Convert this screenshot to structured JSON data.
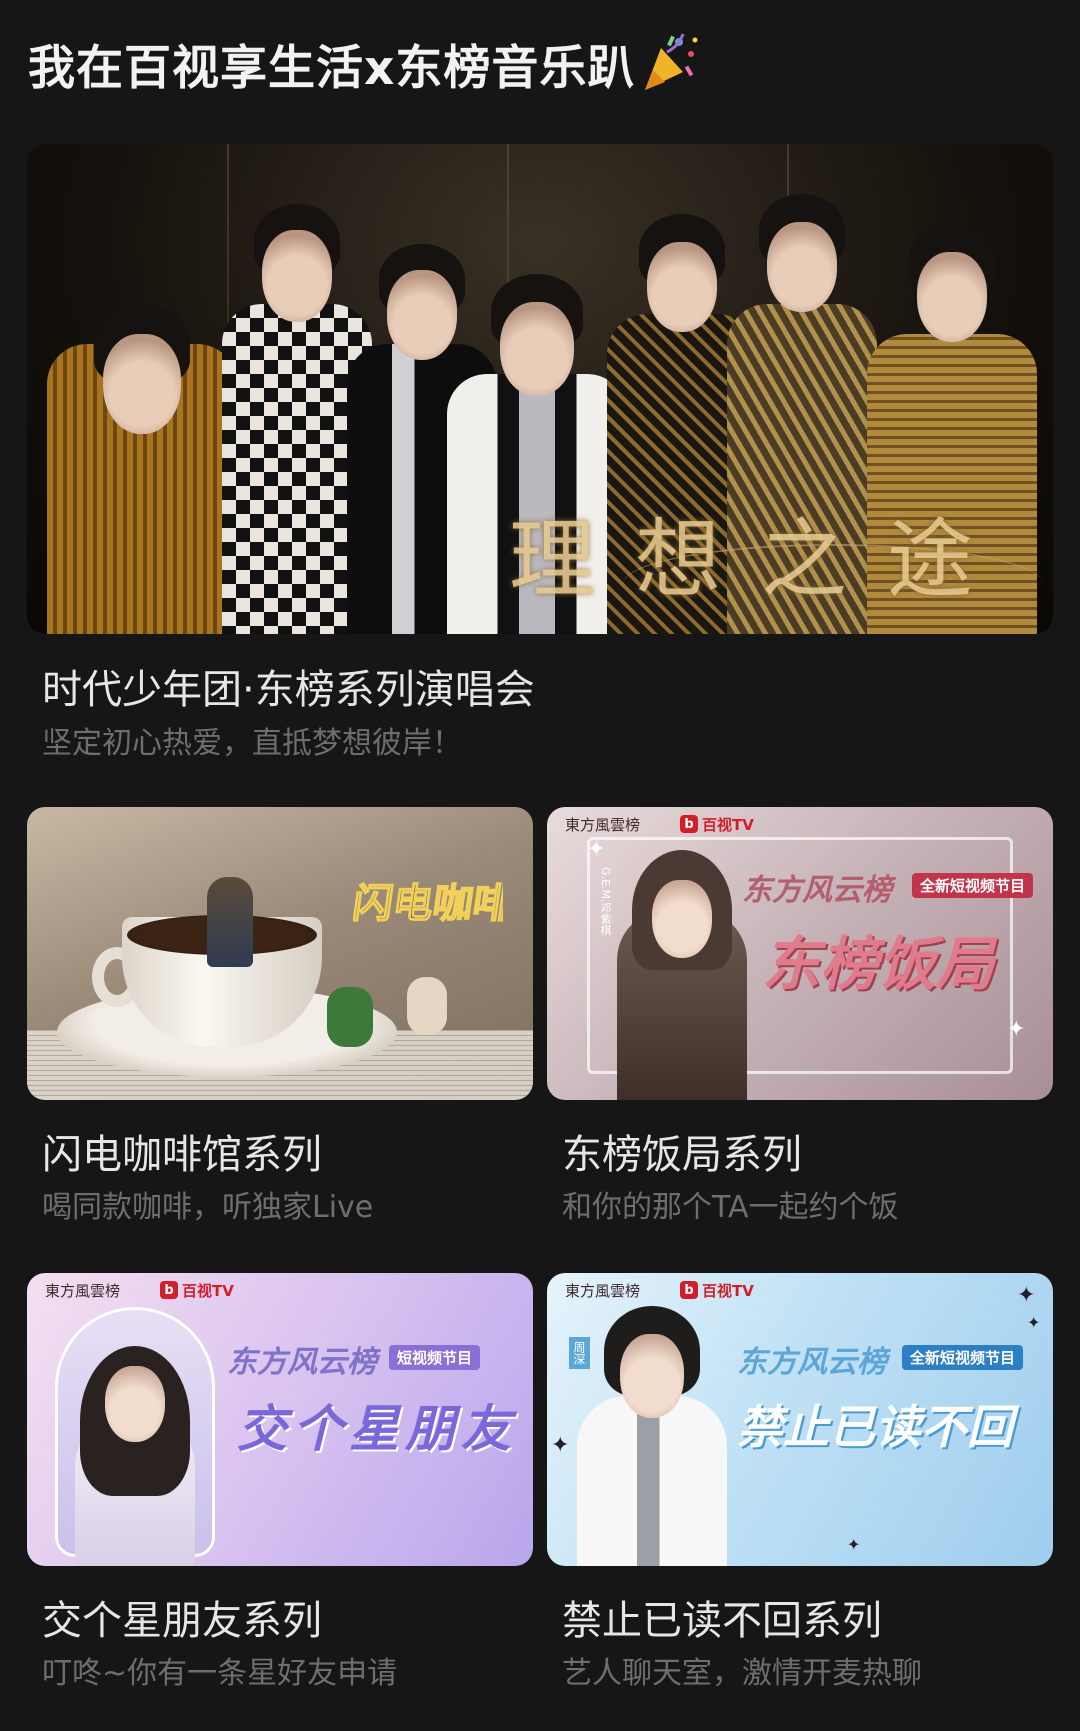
{
  "page": {
    "title": "我在百视享生活x东榜音乐趴",
    "title_icon": "party-popper-icon"
  },
  "hero": {
    "caption": "理想之途",
    "title": "时代少年团·东榜系列演唱会",
    "subtitle": "坚定初心热爱，直抵梦想彼岸！"
  },
  "cards": [
    {
      "id": "cafe",
      "logo_text": "闪电咖啡馆",
      "title": "闪电咖啡馆系列",
      "subtitle": "喝同款咖啡，听独家Live"
    },
    {
      "id": "fanju",
      "brand": "東方風雲榜",
      "tv": "百视TV",
      "headline": "东方风云榜",
      "tag": "全新短视频节目",
      "main": "东榜饭局",
      "side_label": "G.E.M.邓紫棋",
      "title": "东榜饭局系列",
      "subtitle": "和你的那个TA一起约个饭"
    },
    {
      "id": "xingpengyou",
      "brand": "東方風雲榜",
      "tv": "百视TV",
      "headline": "东方风云榜",
      "tag": "短视频节目",
      "main": "交个星朋友",
      "title": "交个星朋友系列",
      "subtitle": "叮咚~你有一条星好友申请"
    },
    {
      "id": "jinzhi",
      "brand": "東方風雲榜",
      "tv": "百视TV",
      "headline": "东方风云榜",
      "tag": "全新短视频节目",
      "main": "禁止已读不回",
      "side_label": "周深",
      "title": "禁止已读不回系列",
      "subtitle": "艺人聊天室，激情开麦热聊"
    }
  ],
  "colors": {
    "background": "#161616",
    "title_text": "#e6e6e6",
    "subtitle_text": "#6e6e6e",
    "gold": "#e5c88e",
    "brand_red": "#d11f2a"
  }
}
